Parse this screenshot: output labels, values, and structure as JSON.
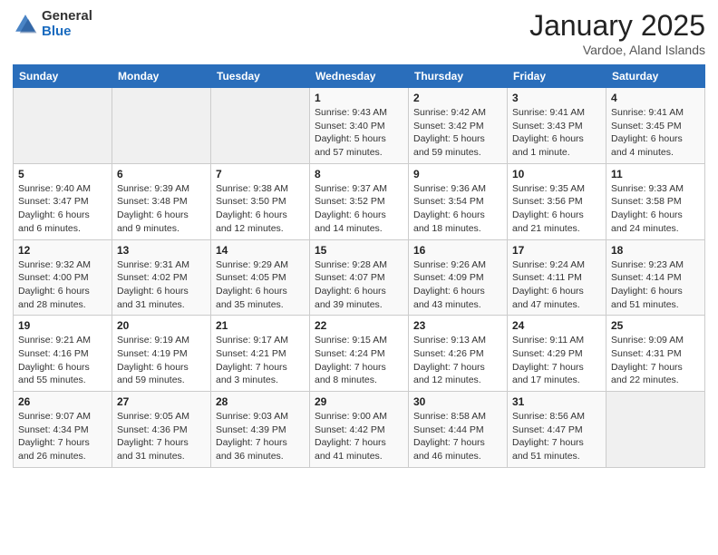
{
  "logo": {
    "general": "General",
    "blue": "Blue"
  },
  "header": {
    "month": "January 2025",
    "location": "Vardoe, Aland Islands"
  },
  "days_of_week": [
    "Sunday",
    "Monday",
    "Tuesday",
    "Wednesday",
    "Thursday",
    "Friday",
    "Saturday"
  ],
  "weeks": [
    [
      {
        "day": "",
        "info": ""
      },
      {
        "day": "",
        "info": ""
      },
      {
        "day": "",
        "info": ""
      },
      {
        "day": "1",
        "info": "Sunrise: 9:43 AM\nSunset: 3:40 PM\nDaylight: 5 hours and 57 minutes."
      },
      {
        "day": "2",
        "info": "Sunrise: 9:42 AM\nSunset: 3:42 PM\nDaylight: 5 hours and 59 minutes."
      },
      {
        "day": "3",
        "info": "Sunrise: 9:41 AM\nSunset: 3:43 PM\nDaylight: 6 hours and 1 minute."
      },
      {
        "day": "4",
        "info": "Sunrise: 9:41 AM\nSunset: 3:45 PM\nDaylight: 6 hours and 4 minutes."
      }
    ],
    [
      {
        "day": "5",
        "info": "Sunrise: 9:40 AM\nSunset: 3:47 PM\nDaylight: 6 hours and 6 minutes."
      },
      {
        "day": "6",
        "info": "Sunrise: 9:39 AM\nSunset: 3:48 PM\nDaylight: 6 hours and 9 minutes."
      },
      {
        "day": "7",
        "info": "Sunrise: 9:38 AM\nSunset: 3:50 PM\nDaylight: 6 hours and 12 minutes."
      },
      {
        "day": "8",
        "info": "Sunrise: 9:37 AM\nSunset: 3:52 PM\nDaylight: 6 hours and 14 minutes."
      },
      {
        "day": "9",
        "info": "Sunrise: 9:36 AM\nSunset: 3:54 PM\nDaylight: 6 hours and 18 minutes."
      },
      {
        "day": "10",
        "info": "Sunrise: 9:35 AM\nSunset: 3:56 PM\nDaylight: 6 hours and 21 minutes."
      },
      {
        "day": "11",
        "info": "Sunrise: 9:33 AM\nSunset: 3:58 PM\nDaylight: 6 hours and 24 minutes."
      }
    ],
    [
      {
        "day": "12",
        "info": "Sunrise: 9:32 AM\nSunset: 4:00 PM\nDaylight: 6 hours and 28 minutes."
      },
      {
        "day": "13",
        "info": "Sunrise: 9:31 AM\nSunset: 4:02 PM\nDaylight: 6 hours and 31 minutes."
      },
      {
        "day": "14",
        "info": "Sunrise: 9:29 AM\nSunset: 4:05 PM\nDaylight: 6 hours and 35 minutes."
      },
      {
        "day": "15",
        "info": "Sunrise: 9:28 AM\nSunset: 4:07 PM\nDaylight: 6 hours and 39 minutes."
      },
      {
        "day": "16",
        "info": "Sunrise: 9:26 AM\nSunset: 4:09 PM\nDaylight: 6 hours and 43 minutes."
      },
      {
        "day": "17",
        "info": "Sunrise: 9:24 AM\nSunset: 4:11 PM\nDaylight: 6 hours and 47 minutes."
      },
      {
        "day": "18",
        "info": "Sunrise: 9:23 AM\nSunset: 4:14 PM\nDaylight: 6 hours and 51 minutes."
      }
    ],
    [
      {
        "day": "19",
        "info": "Sunrise: 9:21 AM\nSunset: 4:16 PM\nDaylight: 6 hours and 55 minutes."
      },
      {
        "day": "20",
        "info": "Sunrise: 9:19 AM\nSunset: 4:19 PM\nDaylight: 6 hours and 59 minutes."
      },
      {
        "day": "21",
        "info": "Sunrise: 9:17 AM\nSunset: 4:21 PM\nDaylight: 7 hours and 3 minutes."
      },
      {
        "day": "22",
        "info": "Sunrise: 9:15 AM\nSunset: 4:24 PM\nDaylight: 7 hours and 8 minutes."
      },
      {
        "day": "23",
        "info": "Sunrise: 9:13 AM\nSunset: 4:26 PM\nDaylight: 7 hours and 12 minutes."
      },
      {
        "day": "24",
        "info": "Sunrise: 9:11 AM\nSunset: 4:29 PM\nDaylight: 7 hours and 17 minutes."
      },
      {
        "day": "25",
        "info": "Sunrise: 9:09 AM\nSunset: 4:31 PM\nDaylight: 7 hours and 22 minutes."
      }
    ],
    [
      {
        "day": "26",
        "info": "Sunrise: 9:07 AM\nSunset: 4:34 PM\nDaylight: 7 hours and 26 minutes."
      },
      {
        "day": "27",
        "info": "Sunrise: 9:05 AM\nSunset: 4:36 PM\nDaylight: 7 hours and 31 minutes."
      },
      {
        "day": "28",
        "info": "Sunrise: 9:03 AM\nSunset: 4:39 PM\nDaylight: 7 hours and 36 minutes."
      },
      {
        "day": "29",
        "info": "Sunrise: 9:00 AM\nSunset: 4:42 PM\nDaylight: 7 hours and 41 minutes."
      },
      {
        "day": "30",
        "info": "Sunrise: 8:58 AM\nSunset: 4:44 PM\nDaylight: 7 hours and 46 minutes."
      },
      {
        "day": "31",
        "info": "Sunrise: 8:56 AM\nSunset: 4:47 PM\nDaylight: 7 hours and 51 minutes."
      },
      {
        "day": "",
        "info": ""
      }
    ]
  ]
}
